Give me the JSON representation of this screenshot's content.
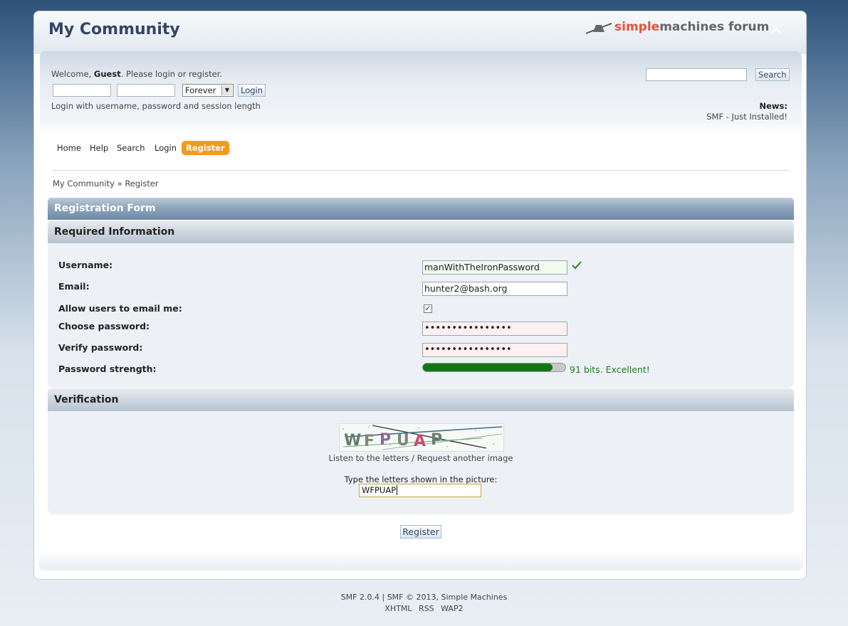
{
  "header": {
    "forum_title": "My Community",
    "logo_text_accent": "simple",
    "logo_text_rest": "machines forum",
    "collapse_icon": "chevron-up-icon"
  },
  "user_area": {
    "welcome_prefix": "Welcome,",
    "guest": "Guest",
    "welcome_suffix": ". Please login or register.",
    "username_value": "",
    "password_value": "",
    "session_length": "Forever",
    "login_button": "Login",
    "hint": "Login with username, password and session length"
  },
  "search": {
    "input_value": "",
    "button": "Search"
  },
  "news": {
    "label": "News:",
    "text": "SMF - Just Installed!"
  },
  "menu": {
    "items": [
      "Home",
      "Help",
      "Search",
      "Login",
      "Register"
    ],
    "active": "Register"
  },
  "breadcrumb": {
    "root": "My Community",
    "separator": "»",
    "current": "Register"
  },
  "form": {
    "title": "Registration Form",
    "required_section": "Required Information",
    "fields": {
      "username_label": "Username:",
      "username_value": "manWithTheIronPassword",
      "email_label": "Email:",
      "email_value": "hunter2@bash.org",
      "allow_email_label": "Allow users to email me:",
      "allow_email_checked": true,
      "choose_password_label": "Choose password:",
      "choose_password_value": "••••••••••••••••",
      "verify_password_label": "Verify password:",
      "verify_password_value": "••••••••••••••••",
      "strength_label": "Password strength:",
      "strength_text": "91 bits. Excellent!",
      "strength_fraction": 0.91
    },
    "verification_section": "Verification",
    "captcha": {
      "image_letters": "WFPUAP",
      "listen_link": "Listen to the letters",
      "link_separator": "/",
      "request_link": "Request another image",
      "prompt": "Type the letters shown in the picture:",
      "input_value": "WFPUAP"
    },
    "register_button": "Register"
  },
  "footer": {
    "version": "SMF 2.0.4",
    "copyright": "SMF © 2013, Simple Machines",
    "links": [
      "XHTML",
      "RSS",
      "WAP2"
    ]
  },
  "colors": {
    "accent": "#f39b1c",
    "title": "#334466",
    "strength_good": "#117711"
  }
}
